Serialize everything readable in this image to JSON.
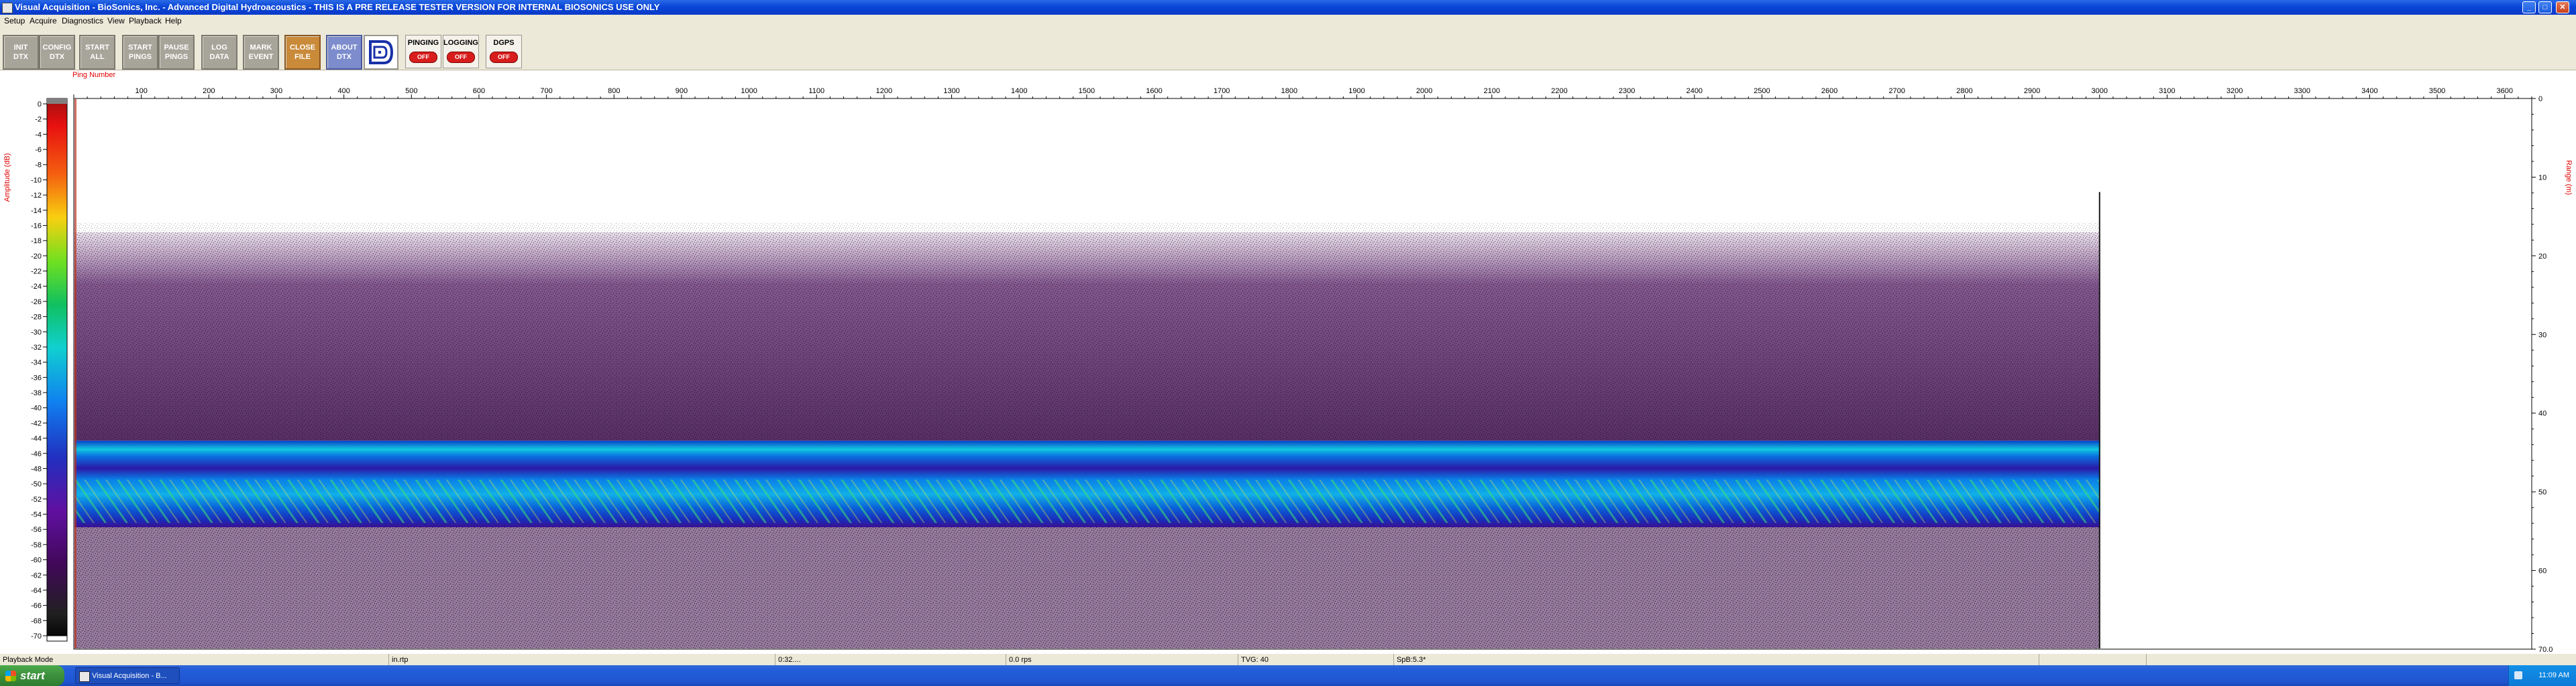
{
  "window": {
    "title": "Visual Acquisition  -  BioSonics, Inc.  -  Advanced Digital Hydroacoustics  -  THIS IS A PRE RELEASE TESTER VERSION FOR INTERNAL BIOSONICS USE ONLY",
    "minimize_glyph": "_",
    "maximize_glyph": "□",
    "close_glyph": "✕"
  },
  "menu": {
    "items": [
      "Setup",
      "Acquire",
      "Diagnostics",
      "View",
      "Playback",
      "Help"
    ]
  },
  "toolbar": {
    "buttons": [
      {
        "id": "init-dtx",
        "label": "INIT\nDTX"
      },
      {
        "id": "config-dtx",
        "label": "CONFIG\nDTX"
      },
      {
        "id": "start-all",
        "label": "START\nALL"
      },
      {
        "id": "start-pings",
        "label": "START\nPINGS"
      },
      {
        "id": "pause-pings",
        "label": "PAUSE\nPINGS"
      },
      {
        "id": "log-data",
        "label": "LOG\nDATA"
      },
      {
        "id": "mark-event",
        "label": "MARK\nEVENT"
      },
      {
        "id": "close-file",
        "label": "CLOSE\nFILE"
      },
      {
        "id": "about-dtx",
        "label": "ABOUT\nDTX"
      }
    ],
    "status": [
      {
        "id": "pinging",
        "label": "PINGING",
        "state": "OFF"
      },
      {
        "id": "logging",
        "label": "LOGGING",
        "state": "OFF"
      },
      {
        "id": "dgps",
        "label": "DGPS",
        "state": "OFF"
      }
    ]
  },
  "echogram": {
    "top_axis_label": "Ping Number",
    "left_axis_label": "Amplitude (dB)",
    "right_axis_label": "Range (m)",
    "ping_ticks": [
      100,
      200,
      300,
      400,
      500,
      600,
      700,
      800,
      900,
      1000,
      1100,
      1200,
      1300,
      1400,
      1500,
      1600,
      1700,
      1800,
      1900,
      2000,
      2100,
      2200,
      2300,
      2400,
      2500,
      2600,
      2700,
      2800,
      2900,
      3000,
      3100,
      3200,
      3300,
      3400,
      3500,
      3600
    ],
    "ping_range": [
      0,
      3640
    ],
    "ping_data_end": 3000,
    "amplitude_ticks": [
      "0",
      "-2",
      "-4",
      "-6",
      "-8",
      "-10",
      "-12",
      "-14",
      "-16",
      "-18",
      "-20",
      "-22",
      "-24",
      "-26",
      "-28",
      "-30",
      "-32",
      "-34",
      "-36",
      "-38",
      "-40",
      "-42",
      "-44",
      "-46",
      "-48",
      "-50",
      "-52",
      "-54",
      "-56",
      "-58",
      "-60",
      "-62",
      "-64",
      "-66",
      "-68",
      "-70"
    ],
    "range_ticks": [
      "0",
      "10",
      "20",
      "30",
      "40",
      "50",
      "60",
      "70.0"
    ],
    "range_max_m": 70,
    "scatter_top_m": 17,
    "bottom_band_m": [
      43.5,
      54.5
    ],
    "colors": {
      "scatter": "#3a0a4a",
      "band_strong": "#00a0e8",
      "band_hot": "#30e060",
      "axis_label": "#e00000"
    }
  },
  "statusbar": {
    "mode": "Playback Mode",
    "file": "in.rtp",
    "time": "0:32....",
    "rate": "0.0 rps",
    "tvg": "TVG: 40",
    "spb": "SpB:5.3*"
  },
  "taskbar": {
    "start_label": "start",
    "task_label": "Visual Acquisition - B...",
    "clock": "11:09 AM"
  }
}
